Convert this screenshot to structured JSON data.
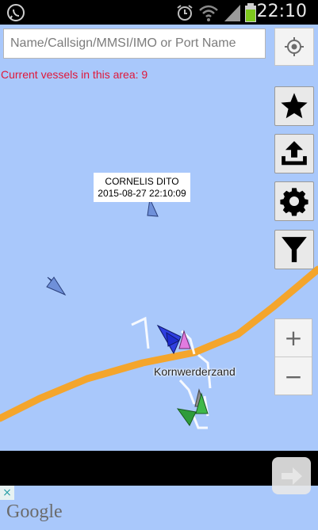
{
  "status_bar": {
    "time": "22:10",
    "icons": [
      "whatsapp-icon",
      "alarm-icon",
      "wifi-icon",
      "signal-icon",
      "battery-icon"
    ]
  },
  "search": {
    "placeholder": "Name/Callsign/MMSI/IMO or Port Name",
    "value": ""
  },
  "vessel_count_text": "Current vessels in this area: 9",
  "toolbar": {
    "buttons": [
      "locate-icon",
      "star-icon",
      "upload-icon",
      "gear-icon",
      "filter-icon"
    ]
  },
  "tooltip": {
    "vessel_name": "CORNELIS DITO",
    "timestamp": "2015-08-27 22:10:09"
  },
  "map": {
    "place_label": "Kornwerderzand",
    "water_color": "#a9c8fb",
    "road_color": "#f4a52c",
    "vessel_colors": [
      "#6f90d9",
      "#2f3fe0",
      "#e27be0",
      "#3fb84a",
      "#2e9c3a",
      "#8c8c8c"
    ]
  },
  "zoom": {
    "in_label": "+",
    "out_label": "−"
  },
  "ad": {
    "close_label": "×",
    "next_icon": "arrow-right-icon"
  },
  "attribution": {
    "logo_text": "Google"
  }
}
